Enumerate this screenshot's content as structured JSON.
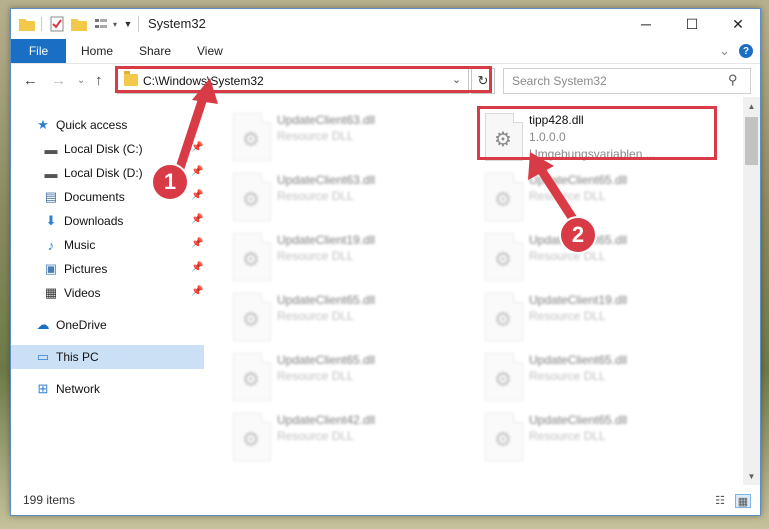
{
  "window": {
    "title": "System32",
    "controls": {
      "minimize": "─",
      "maximize": "☐",
      "close": "✕"
    }
  },
  "ribbon": {
    "file_tab": "File",
    "tabs": [
      "Home",
      "Share",
      "View"
    ],
    "expand_glyph": "⌄",
    "help_glyph": "?"
  },
  "nav": {
    "back": "←",
    "forward": "→",
    "recent": "⌄",
    "up": "↑",
    "address": "C:\\Windows\\System32",
    "address_dropdown": "⌄",
    "refresh": "↻",
    "search_placeholder": "Search System32",
    "search_glyph": "⚲"
  },
  "sidebar": {
    "items": [
      {
        "label": "Quick access",
        "icon": "star-icon",
        "glyph": "★",
        "color": "#2f7fd1"
      },
      {
        "label": "Local Disk (C:)",
        "icon": "disk-icon",
        "glyph": "▬",
        "color": "#555555",
        "pinned": true
      },
      {
        "label": "Local Disk (D:)",
        "icon": "disk-icon",
        "glyph": "▬",
        "color": "#555555",
        "pinned": true
      },
      {
        "label": "Documents",
        "icon": "document-icon",
        "glyph": "▤",
        "color": "#4a6fa5",
        "pinned": true
      },
      {
        "label": "Downloads",
        "icon": "download-icon",
        "glyph": "⬇",
        "color": "#2f7fd1",
        "pinned": true
      },
      {
        "label": "Music",
        "icon": "music-icon",
        "glyph": "♪",
        "color": "#2f7fd1",
        "pinned": true
      },
      {
        "label": "Pictures",
        "icon": "pictures-icon",
        "glyph": "▣",
        "color": "#4a7fb5",
        "pinned": true
      },
      {
        "label": "Videos",
        "icon": "videos-icon",
        "glyph": "▦",
        "color": "#333333",
        "pinned": true
      },
      {
        "label": "OneDrive",
        "icon": "cloud-icon",
        "glyph": "☁",
        "color": "#1a6fc4"
      },
      {
        "label": "This PC",
        "icon": "computer-icon",
        "glyph": "▭",
        "color": "#2f7fd1",
        "selected": true
      },
      {
        "label": "Network",
        "icon": "network-icon",
        "glyph": "⊞",
        "color": "#2f7fd1"
      }
    ],
    "pin_glyph": "📌"
  },
  "files": {
    "highlighted": {
      "name": "tipp428.dll",
      "version": "1.0.0.0",
      "description": "Umgebungsvariablen ..."
    },
    "left_column": [
      {
        "name": "UpdateClient63.dll",
        "type": "Resource DLL"
      },
      {
        "name": "UpdateClient63.dll",
        "type": "Resource DLL"
      },
      {
        "name": "UpdateClient19.dll",
        "type": "Resource DLL"
      },
      {
        "name": "UpdateClient65.dll",
        "type": "Resource DLL"
      },
      {
        "name": "UpdateClient65.dll",
        "type": "Resource DLL"
      },
      {
        "name": "UpdateClient42.dll",
        "type": "Resource DLL"
      }
    ],
    "right_column": [
      {
        "name": "UpdateClient65.dll",
        "type": "Resource DLL"
      },
      {
        "name": "UpdateClient65.dll",
        "type": "Resource DLL"
      },
      {
        "name": "UpdateClient19.dll",
        "type": "Resource DLL"
      },
      {
        "name": "UpdateClient65.dll",
        "type": "Resource DLL"
      },
      {
        "name": "UpdateClient65.dll",
        "type": "Resource DLL"
      }
    ],
    "file_glyph": "⚙"
  },
  "status": {
    "item_count": "199 items",
    "details_view_glyph": "☷",
    "tiles_view_glyph": "▦"
  },
  "scroll": {
    "up": "▲",
    "down": "▼"
  },
  "annotations": {
    "step1": "1",
    "step2": "2",
    "color": "#d83b45"
  }
}
